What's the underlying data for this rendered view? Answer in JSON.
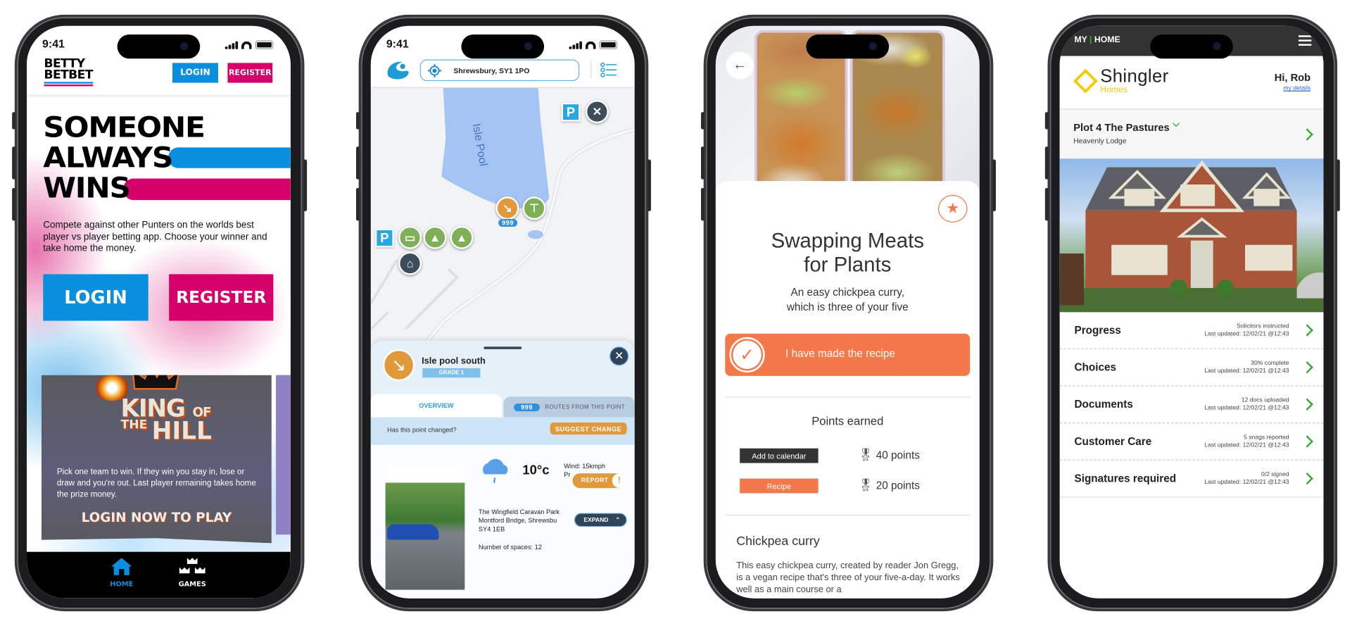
{
  "status_time": "9:41",
  "betty": {
    "logo": [
      "BETTY",
      "BETBET"
    ],
    "header_login": "LOGIN",
    "header_register": "REGISTER",
    "headline": [
      "SOMEONE",
      "ALWAYS",
      "WINS"
    ],
    "intro": "Compete against other Punters on the worlds best player vs player betting app. Choose your winner and take home the money.",
    "login": "LOGIN",
    "register": "REGISTER",
    "card": {
      "title_1": "KING",
      "title_of": "OF",
      "title_2": "THE",
      "title_3": "HILL",
      "text": "Pick one team to win. If they win you stay in, lose or draw and you're out. Last player remaining takes home the prize money.",
      "cta": "LOGIN NOW TO PLAY"
    },
    "nav": [
      {
        "label": "HOME",
        "icon": "home-icon",
        "active": true
      },
      {
        "label": "GAMES",
        "icon": "crowns-icon",
        "active": false
      }
    ],
    "colors": {
      "blue": "#0a8fdf",
      "pink": "#d6006b"
    }
  },
  "map": {
    "location": "Shrewsbury, SY1 1PO",
    "lake_label": "Isle Pool",
    "marker_badge": "999",
    "sheet": {
      "title": "Isle pool south",
      "grade": "GRADE 1",
      "tabs": [
        {
          "label": "OVERVIEW",
          "active": true
        },
        {
          "badge": "999",
          "label": "ROUTES FROM THIS POINT",
          "active": false
        }
      ],
      "changed_q": "Has this point changed?",
      "suggest": "SUGGEST CHANGE",
      "temp": "10°c",
      "wind": "Wind: 15kmph",
      "wind_2": "Pr",
      "report": "REPORT",
      "expand": "EXPAND",
      "address": [
        "The Wingfield Caravan Park",
        "Montford Bridge, Shrewsbu",
        "SY4 1EB"
      ],
      "spaces": "Number of spaces: 12"
    }
  },
  "recipe": {
    "title": [
      "Swapping Meats",
      "for Plants"
    ],
    "subtitle": [
      "An easy chickpea curry,",
      "which is three of your five"
    ],
    "made_button": "I have made the recipe",
    "points_heading": "Points earned",
    "points": [
      {
        "tag": "Add to calendar",
        "value": "40 points",
        "tag_color": "#333333"
      },
      {
        "tag": "Recipe",
        "value": "20 points",
        "tag_color": "#f5784a"
      }
    ],
    "section_title": "Chickpea curry",
    "body": "This easy chickpea curry, created by reader Jon Gregg, is a vegan recipe that's three of your five-a-day. It works well as a main course or a",
    "accent": "#f5784a"
  },
  "home": {
    "app": [
      "MY",
      "HOME"
    ],
    "brand": "Shingler",
    "brand_sub": "Homes",
    "greeting": "Hi, Rob",
    "my_details": "my details",
    "plot": "Plot 4 The Pastures",
    "plot_sub": "Heavenly Lodge",
    "rows": [
      {
        "label": "Progress",
        "status": "Solicitors instructed",
        "updated": "Last updated: 12/02/21 @12:43"
      },
      {
        "label": "Choices",
        "status": "30% complete",
        "updated": "Last updated: 12/02/21 @12:43"
      },
      {
        "label": "Documents",
        "status": "12 docs uploaded",
        "updated": "Last updated: 12/02/21 @12:43"
      },
      {
        "label": "Customer Care",
        "status": "5 snags reported",
        "updated": "Last updated: 12/02/21 @12:43"
      },
      {
        "label": "Signatures required",
        "status": "0/2 signed",
        "updated": "Last updated: 12/02/21 @12:43"
      }
    ],
    "colors": {
      "green": "#3aaa35",
      "yellow": "#f6c800"
    }
  }
}
